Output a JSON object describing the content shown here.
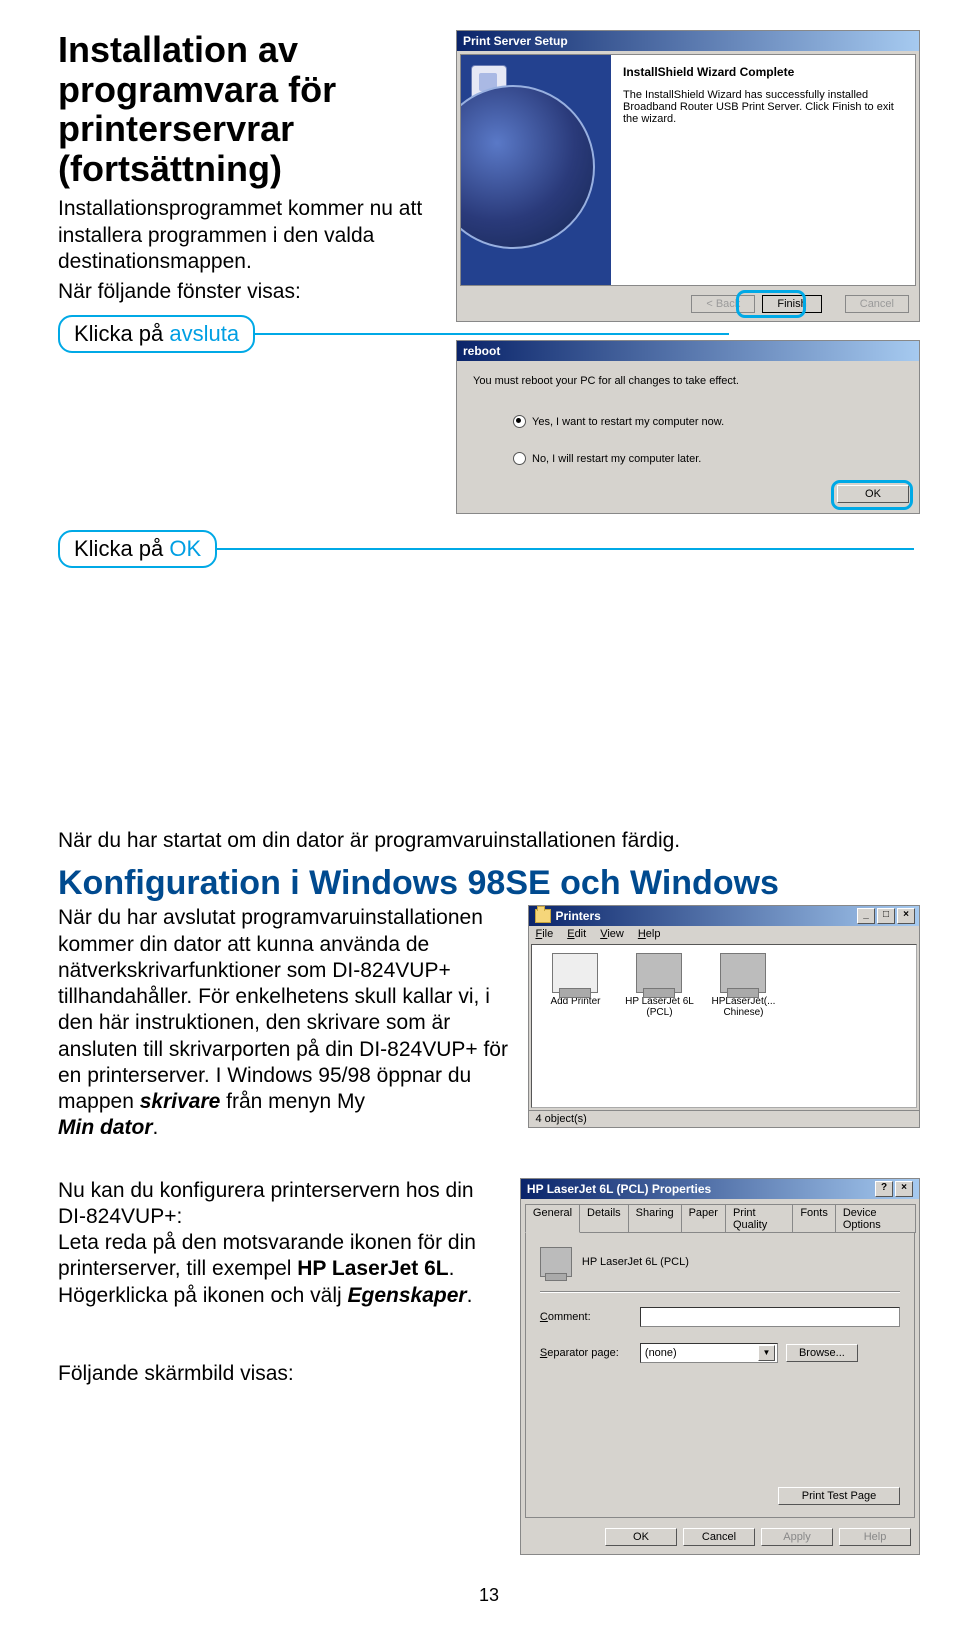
{
  "heading": "Installation av programvara för printerservrar (fortsättning)",
  "intro_p1": "Installationsprogrammet kommer nu att installera programmen i den valda destinationsmappen.",
  "intro_p2": "När följande fönster visas:",
  "callout_finish_prefix": "Klicka på ",
  "callout_finish_word": "avsluta",
  "callout_ok_prefix": "Klicka på ",
  "callout_ok_word": "OK",
  "after_restart": "När du har startat om din dator är programvaruinstallationen färdig.",
  "h2": "Konfiguration i Windows 98SE och Windows",
  "config_p": "När du har avslutat programvaruinstallationen kommer din dator att kunna använda de nätverkskrivarfunktioner som DI-824VUP+ tillhandahåller. För enkelhetens skull kallar vi, i den här instruktionen, den skrivare som är ansluten till skrivarporten på din DI-824VUP+ för en printerserver. I Windows 95/98 öppnar du mappen ",
  "config_p_em": "skrivare",
  "config_p_tail": " från menyn My ",
  "config_p_em2": "Min dator",
  "config_p_tail2": ".",
  "props_intro1": "Nu kan du konfigurera printerservern hos din DI-824VUP+:",
  "props_intro2a": "Leta reda på den motsvarande ikonen för din printerserver, till exempel ",
  "props_intro2b": "HP LaserJet 6L",
  "props_intro2c": ". Högerklicka på ikonen och välj ",
  "props_intro2d": "Egenskaper",
  "props_intro2e": ".",
  "following": "Följande skärmbild visas:",
  "page_num": "13",
  "wizard": {
    "title": "Print Server Setup",
    "complete": "InstallShield Wizard Complete",
    "text": "The InstallShield Wizard has successfully installed Broadband Router USB Print Server. Click Finish to exit the wizard.",
    "back": "< Back",
    "finish": "Finish",
    "cancel": "Cancel"
  },
  "reboot": {
    "title": "reboot",
    "msg": "You must reboot your PC for all changes to take effect.",
    "opt_yes": "Yes, I want to restart my computer now.",
    "opt_no": "No, I will restart my computer later.",
    "ok": "OK"
  },
  "printers": {
    "title": "Printers",
    "menu": [
      "File",
      "Edit",
      "View",
      "Help"
    ],
    "add": "Add Printer",
    "p1": "HP LaserJet 6L (PCL)",
    "p2": "HPLaserJet(... Chinese)",
    "status": "4 object(s)"
  },
  "props": {
    "title": "HP LaserJet 6L (PCL) Properties",
    "tabs": [
      "General",
      "Details",
      "Sharing",
      "Paper",
      "Print Quality",
      "Fonts",
      "Device Options"
    ],
    "name": "HP LaserJet 6L (PCL)",
    "comment_lbl": "Comment:",
    "sep_lbl": "Separator page:",
    "sep_val": "(none)",
    "browse": "Browse...",
    "testpage": "Print Test Page",
    "ok": "OK",
    "cancel": "Cancel",
    "apply": "Apply",
    "help": "Help"
  }
}
